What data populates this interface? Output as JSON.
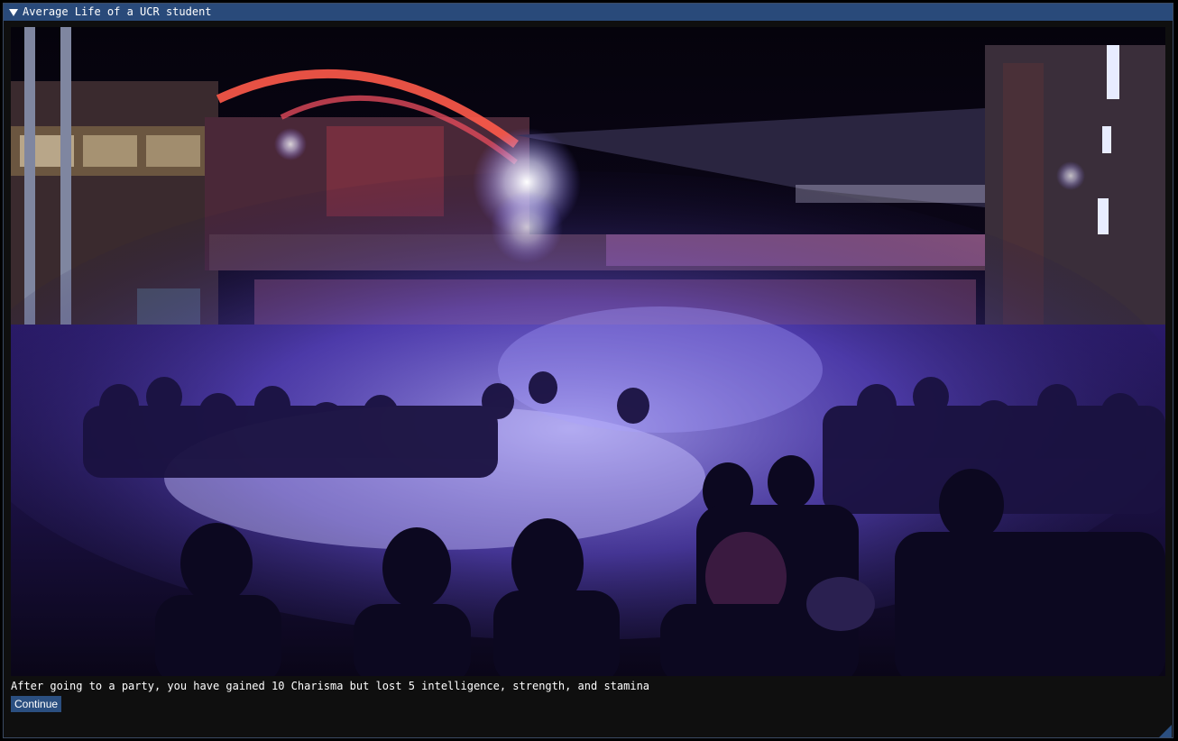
{
  "window": {
    "title": "Average Life of a UCR student",
    "collapse_icon": "triangle-down-icon"
  },
  "scene_image": {
    "subject": "concert-crowd-photo"
  },
  "event": {
    "message": "After going to a party, you have gained 10 Charisma but lost 5 intelligence, strength, and stamina",
    "continue_label": "Continue"
  },
  "colors": {
    "titlebar": "#294a7a",
    "button": "#2b4f80",
    "window_bg": "#0f0f0f",
    "text": "#ffffff"
  }
}
